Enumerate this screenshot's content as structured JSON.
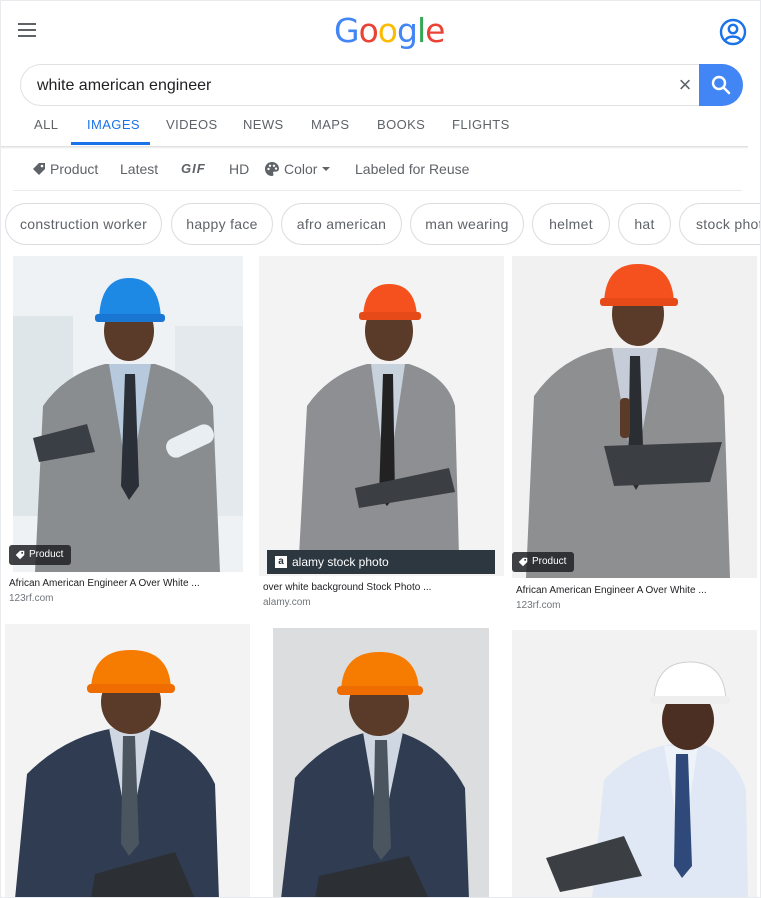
{
  "logo": {
    "letters": [
      "G",
      "o",
      "o",
      "g",
      "l",
      "e"
    ]
  },
  "search": {
    "value": "white american engineer",
    "clear_label": "×"
  },
  "tabs": [
    {
      "label": "ALL"
    },
    {
      "label": "IMAGES"
    },
    {
      "label": "VIDEOS"
    },
    {
      "label": "NEWS"
    },
    {
      "label": "MAPS"
    },
    {
      "label": "BOOKS"
    },
    {
      "label": "FLIGHTS"
    }
  ],
  "active_tab": "IMAGES",
  "tools": {
    "product": "Product",
    "latest": "Latest",
    "gif": "GIF",
    "hd": "HD",
    "color": "Color",
    "labeled": "Labeled for Reuse"
  },
  "chips": [
    "construction worker",
    "happy face",
    "afro american",
    "man wearing",
    "helmet",
    "hat",
    "stock photo"
  ],
  "results": [
    {
      "title": "African American Engineer A Over White ...",
      "source": "123rf.com",
      "badge": "Product",
      "helmet_color": "#1e88e5"
    },
    {
      "title": "over white background Stock Photo ...",
      "source": "alamy.com",
      "overlay": "alamy stock photo",
      "helmet_color": "#f4511e"
    },
    {
      "title": "African American Engineer A Over White ...",
      "source": "123rf.com",
      "badge": "Product",
      "helmet_color": "#f4511e"
    },
    {
      "helmet_color": "#f57c00"
    },
    {
      "helmet_color": "#f57c00"
    },
    {
      "helmet_color": "#ffffff"
    }
  ],
  "colors": {
    "accent": "#1a73e8",
    "search_button": "#4285f4",
    "text_secondary": "#5f6368"
  }
}
